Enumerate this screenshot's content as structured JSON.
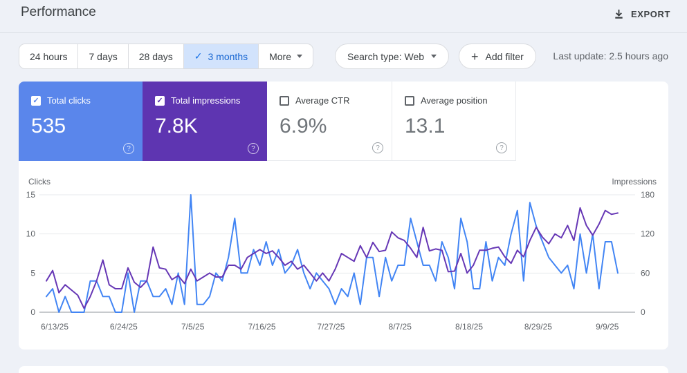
{
  "icons": {
    "check": "✓",
    "plus": "+",
    "help": "?"
  },
  "header": {
    "title": "Performance",
    "export_label": "EXPORT"
  },
  "filters": {
    "date_tabs": [
      {
        "label": "24 hours",
        "selected": false
      },
      {
        "label": "7 days",
        "selected": false
      },
      {
        "label": "28 days",
        "selected": false
      },
      {
        "label": "3 months",
        "selected": true
      }
    ],
    "more_label": "More",
    "search_type": "Search type: Web",
    "add_filter": "Add filter",
    "last_update": "Last update: 2.5 hours ago"
  },
  "metrics": [
    {
      "label": "Total clicks",
      "value": "535",
      "checked": true,
      "bg": "#5a86eb"
    },
    {
      "label": "Total impressions",
      "value": "7.8K",
      "checked": true,
      "bg": "#5e35b1"
    },
    {
      "label": "Average CTR",
      "value": "6.9%",
      "checked": false,
      "bg": "#ffffff"
    },
    {
      "label": "Average position",
      "value": "13.1",
      "checked": false,
      "bg": "#ffffff"
    }
  ],
  "chart_data": {
    "type": "line",
    "left_axis": {
      "label": "Clicks",
      "ticks": [
        0,
        5,
        10,
        15
      ],
      "range": [
        0,
        15
      ]
    },
    "right_axis": {
      "label": "Impressions",
      "ticks": [
        0,
        60,
        120,
        180
      ],
      "range": [
        0,
        180
      ]
    },
    "x_tick_labels": [
      "6/13/25",
      "6/24/25",
      "7/5/25",
      "7/16/25",
      "7/27/25",
      "8/7/25",
      "8/18/25",
      "8/29/25",
      "9/9/25"
    ],
    "x_tick_indices": [
      0,
      11,
      22,
      33,
      44,
      55,
      66,
      77,
      88
    ],
    "cadence": "daily",
    "grid": true,
    "colors": {
      "gridline": "#e7e9ec",
      "zero_line": "#8f959b",
      "tick_text": "#5f6368"
    },
    "series": [
      {
        "name": "Clicks",
        "axis": "left",
        "color": "#4285f4",
        "values": [
          2,
          3,
          0,
          2,
          0,
          0,
          0,
          4,
          4,
          2,
          2,
          0,
          0,
          5,
          0,
          4,
          4,
          2,
          2,
          3,
          1,
          5,
          1,
          15,
          1,
          1,
          2,
          5,
          4,
          7,
          12,
          5,
          5,
          8,
          6,
          9,
          6,
          8,
          5,
          6,
          8,
          5,
          3,
          5,
          4,
          3,
          1,
          3,
          2,
          5,
          1,
          7,
          7,
          2,
          7,
          4,
          6,
          6,
          12,
          9,
          6,
          6,
          4,
          9,
          7,
          3,
          12,
          9,
          3,
          3,
          9,
          4,
          7,
          6,
          10,
          13,
          4,
          14,
          11,
          9,
          7,
          6,
          5,
          6,
          3,
          10,
          5,
          10,
          3,
          9,
          9,
          5
        ]
      },
      {
        "name": "Impressions",
        "axis": "right",
        "color": "#6637b5",
        "values": [
          48,
          64,
          30,
          42,
          34,
          26,
          6,
          24,
          48,
          80,
          42,
          36,
          36,
          68,
          46,
          38,
          48,
          100,
          68,
          66,
          50,
          56,
          44,
          66,
          48,
          54,
          60,
          54,
          54,
          72,
          72,
          66,
          84,
          90,
          96,
          90,
          94,
          84,
          72,
          78,
          66,
          72,
          60,
          48,
          60,
          48,
          66,
          90,
          84,
          78,
          102,
          84,
          107,
          93,
          95,
          123,
          114,
          110,
          98,
          84,
          130,
          94,
          97,
          95,
          62,
          63,
          90,
          60,
          72,
          95,
          95,
          98,
          100,
          85,
          75,
          95,
          85,
          110,
          130,
          115,
          105,
          120,
          114,
          133,
          110,
          160,
          133,
          118,
          135,
          156,
          150,
          152
        ]
      }
    ]
  }
}
